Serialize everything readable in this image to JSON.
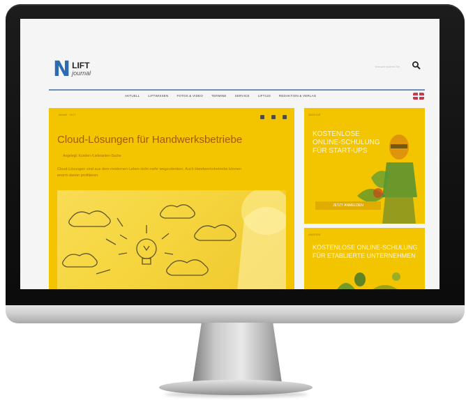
{
  "site": {
    "logo_mark": "N",
    "logo_title": "LIFT",
    "logo_subtitle": "journal",
    "search_placeholder": "Wonach suchen Sie",
    "nav": [
      "AKTUELL",
      "LIFTWISSEN",
      "FOTOS & VIDEO",
      "TERMINE",
      "SERVICE",
      "LIFT123",
      "REDAKTION & VERLAG"
    ]
  },
  "article": {
    "meta": "Aktuell · 2017",
    "title": "Cloud-Lösungen für Handwerksbetriebe",
    "author": "Angelegt: Kunden-/Lieferanten-Suche",
    "text": "Cloud-Lösungen sind aus dem modernen Leben nicht mehr wegzudenken. Auch Handwerksbetriebe können enorm davon profitieren."
  },
  "sidebar": [
    {
      "label": "ANZEIGE",
      "title_lines": [
        "KOSTENLOSE",
        "ONLINE-SCHULUNG",
        "FÜR START-UPS"
      ],
      "button": "JETZT ANMELDEN"
    },
    {
      "label": "ANZEIGE",
      "title_lines": [
        "KOSTENLOSE ONLINE-SCHULUNG",
        "FÜR ETABLIERTE UNTERNEHMEN"
      ]
    }
  ],
  "colors": {
    "accent_yellow": "#f3c400",
    "brand_blue": "#2a6bb3"
  }
}
